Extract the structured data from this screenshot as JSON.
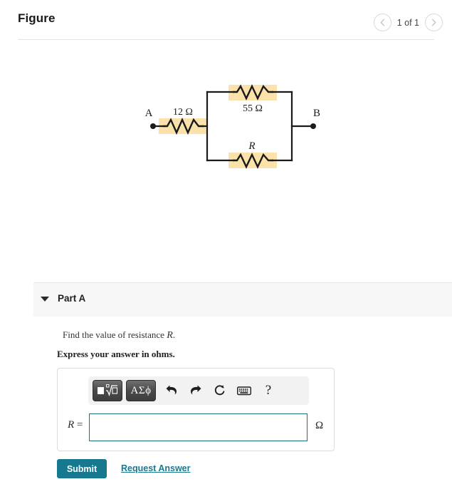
{
  "header": {
    "title": "Figure",
    "pager": {
      "prev_icon": "chevron-left-icon",
      "next_icon": "chevron-right-icon",
      "label": "1 of 1"
    }
  },
  "figure": {
    "type": "circuit-diagram",
    "terminals": [
      {
        "name": "A",
        "label": "A"
      },
      {
        "name": "B",
        "label": "B"
      }
    ],
    "components": [
      {
        "id": "series-resistor",
        "label": "12 Ω",
        "position": "series-left",
        "highlight": "#fbe2ab"
      },
      {
        "id": "parallel-top-resistor",
        "label": "55 Ω",
        "position": "parallel-top",
        "highlight": "#fbe2ab"
      },
      {
        "id": "parallel-bottom-resistor",
        "label": "R",
        "position": "parallel-bottom",
        "highlight": "#fbe2ab",
        "italic": true
      }
    ],
    "wire_color": "#1a1a1a"
  },
  "part": {
    "caret_icon": "caret-down-icon",
    "title": "Part A",
    "question_prefix": "Find the value of resistance ",
    "question_variable": "R",
    "question_suffix": ".",
    "instruction": "Express your answer in ohms."
  },
  "answer": {
    "toolbar": [
      {
        "name": "math-template-button",
        "icon": "nth-root-icon",
        "label": ""
      },
      {
        "name": "greek-symbols-button",
        "icon": "greek-icon",
        "label": "ΑΣϕ"
      },
      {
        "name": "undo-button",
        "icon": "undo-arrow-icon",
        "label": ""
      },
      {
        "name": "redo-button",
        "icon": "redo-arrow-icon",
        "label": ""
      },
      {
        "name": "reset-button",
        "icon": "reset-circular-arrow-icon",
        "label": ""
      },
      {
        "name": "keyboard-button",
        "icon": "keyboard-icon",
        "label": ""
      },
      {
        "name": "help-button",
        "icon": "question-mark-icon",
        "label": "?"
      }
    ],
    "variable_label": "R",
    "equals_sign": "=",
    "input_value": "",
    "input_placeholder": "",
    "unit": "Ω",
    "border_color": "#1d6f7d"
  },
  "actions": {
    "submit_label": "Submit",
    "request_answer_label": "Request Answer",
    "accent_color": "#17798f"
  }
}
